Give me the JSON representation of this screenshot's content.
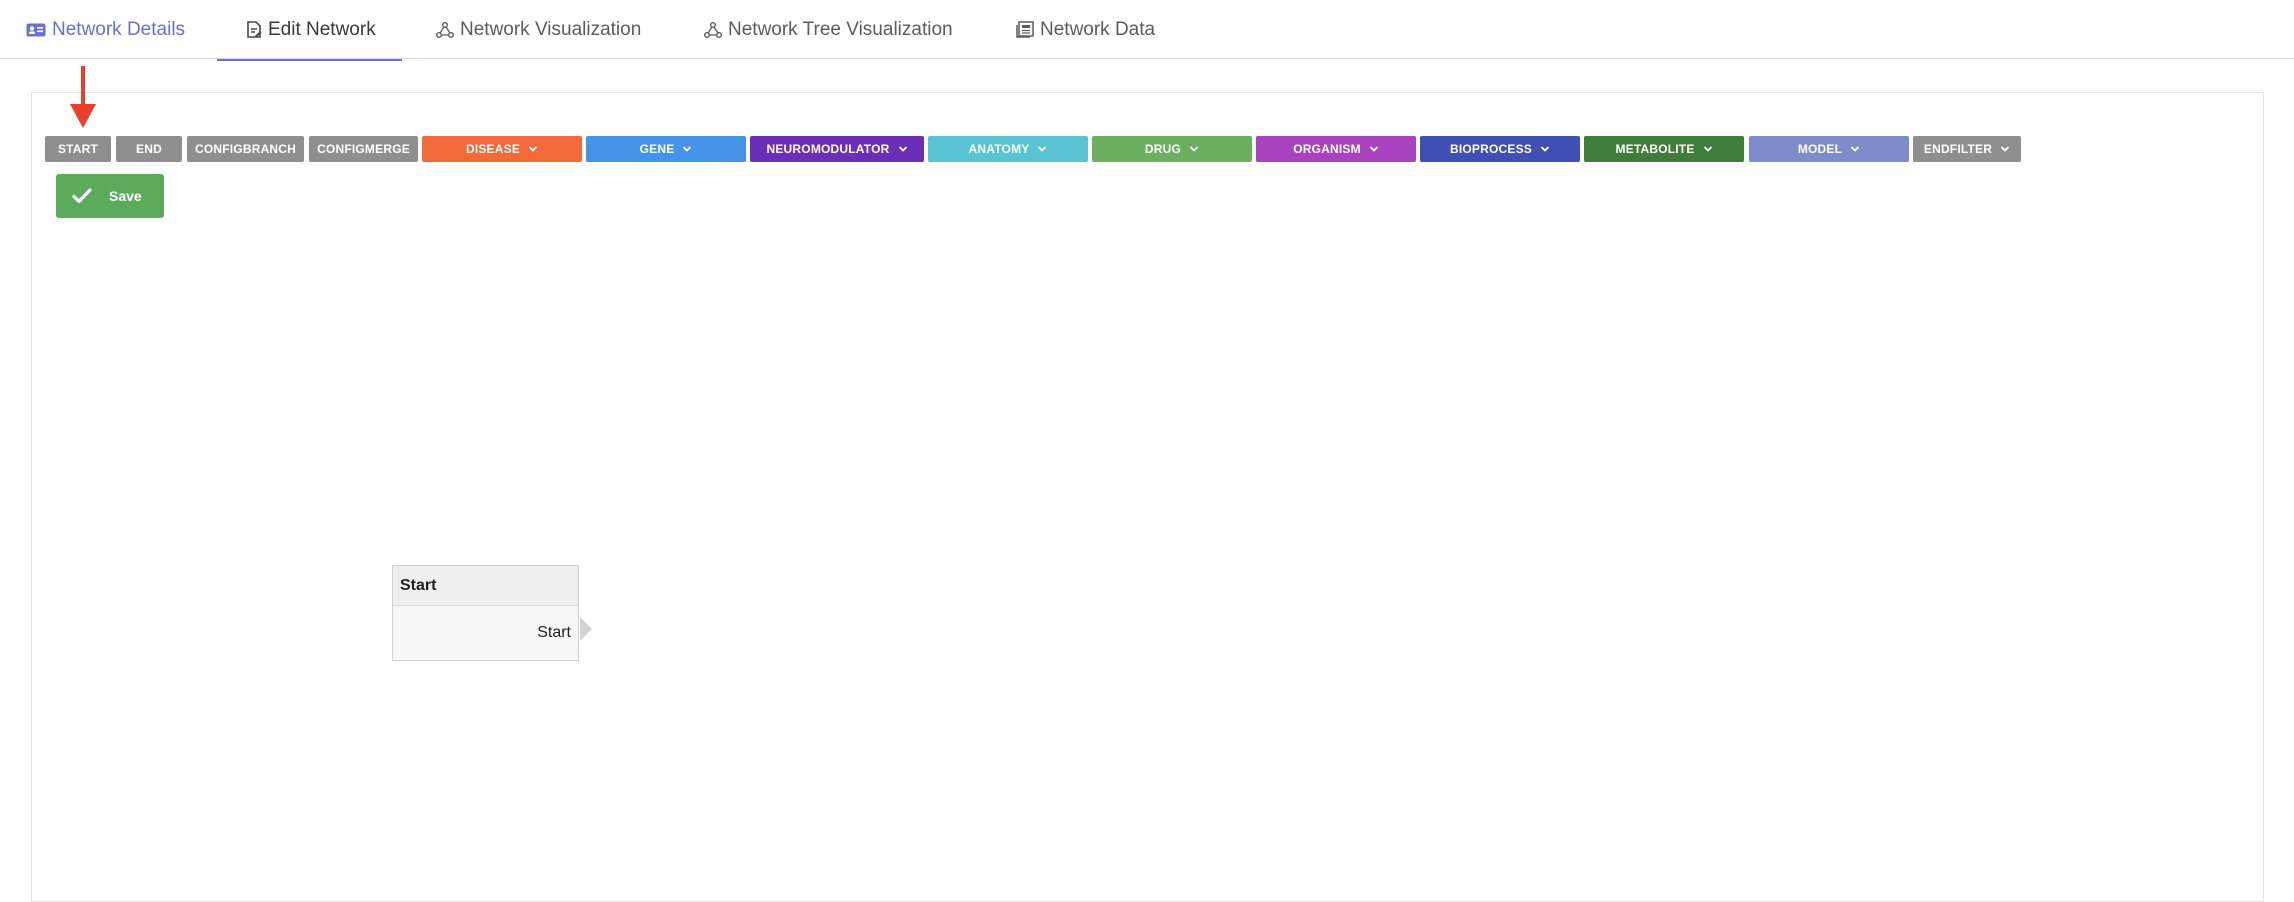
{
  "tabs": [
    {
      "label": "Network Details",
      "icon": "id-card-icon"
    },
    {
      "label": "Edit Network",
      "icon": "edit-document-icon"
    },
    {
      "label": "Network Visualization",
      "icon": "network-icon"
    },
    {
      "label": "Network Tree Visualization",
      "icon": "network-tree-icon"
    },
    {
      "label": "Network Data",
      "icon": "data-table-icon"
    }
  ],
  "toolbar": {
    "buttons": [
      {
        "label": "START",
        "color": "#8f8f8f",
        "dropdown": false
      },
      {
        "label": "END",
        "color": "#8f8f8f",
        "dropdown": false
      },
      {
        "label": "CONFIGBRANCH",
        "color": "#8f8f8f",
        "dropdown": false
      },
      {
        "label": "CONFIGMERGE",
        "color": "#8f8f8f",
        "dropdown": false
      },
      {
        "label": "DISEASE",
        "color": "#f26a3a",
        "dropdown": true
      },
      {
        "label": "GENE",
        "color": "#4594ea",
        "dropdown": true
      },
      {
        "label": "NEUROMODULATOR",
        "color": "#6b2fb6",
        "dropdown": true
      },
      {
        "label": "ANATOMY",
        "color": "#59c3d4",
        "dropdown": true
      },
      {
        "label": "DRUG",
        "color": "#6ab05f",
        "dropdown": true
      },
      {
        "label": "ORGANISM",
        "color": "#a843bd",
        "dropdown": true
      },
      {
        "label": "BIOPROCESS",
        "color": "#3f4fb3",
        "dropdown": true
      },
      {
        "label": "METABOLITE",
        "color": "#3f7d3a",
        "dropdown": true
      },
      {
        "label": "MODEL",
        "color": "#7f8ccc",
        "dropdown": true
      },
      {
        "label": "ENDFILTER",
        "color": "#8f8f8f",
        "dropdown": true
      }
    ],
    "save_label": "Save",
    "save_color": "#5cab5c"
  },
  "annotation": {
    "arrow_color": "#e8402a"
  },
  "node": {
    "title": "Start",
    "output_label": "Start"
  },
  "colors": {
    "accent": "#6a6fd0"
  }
}
